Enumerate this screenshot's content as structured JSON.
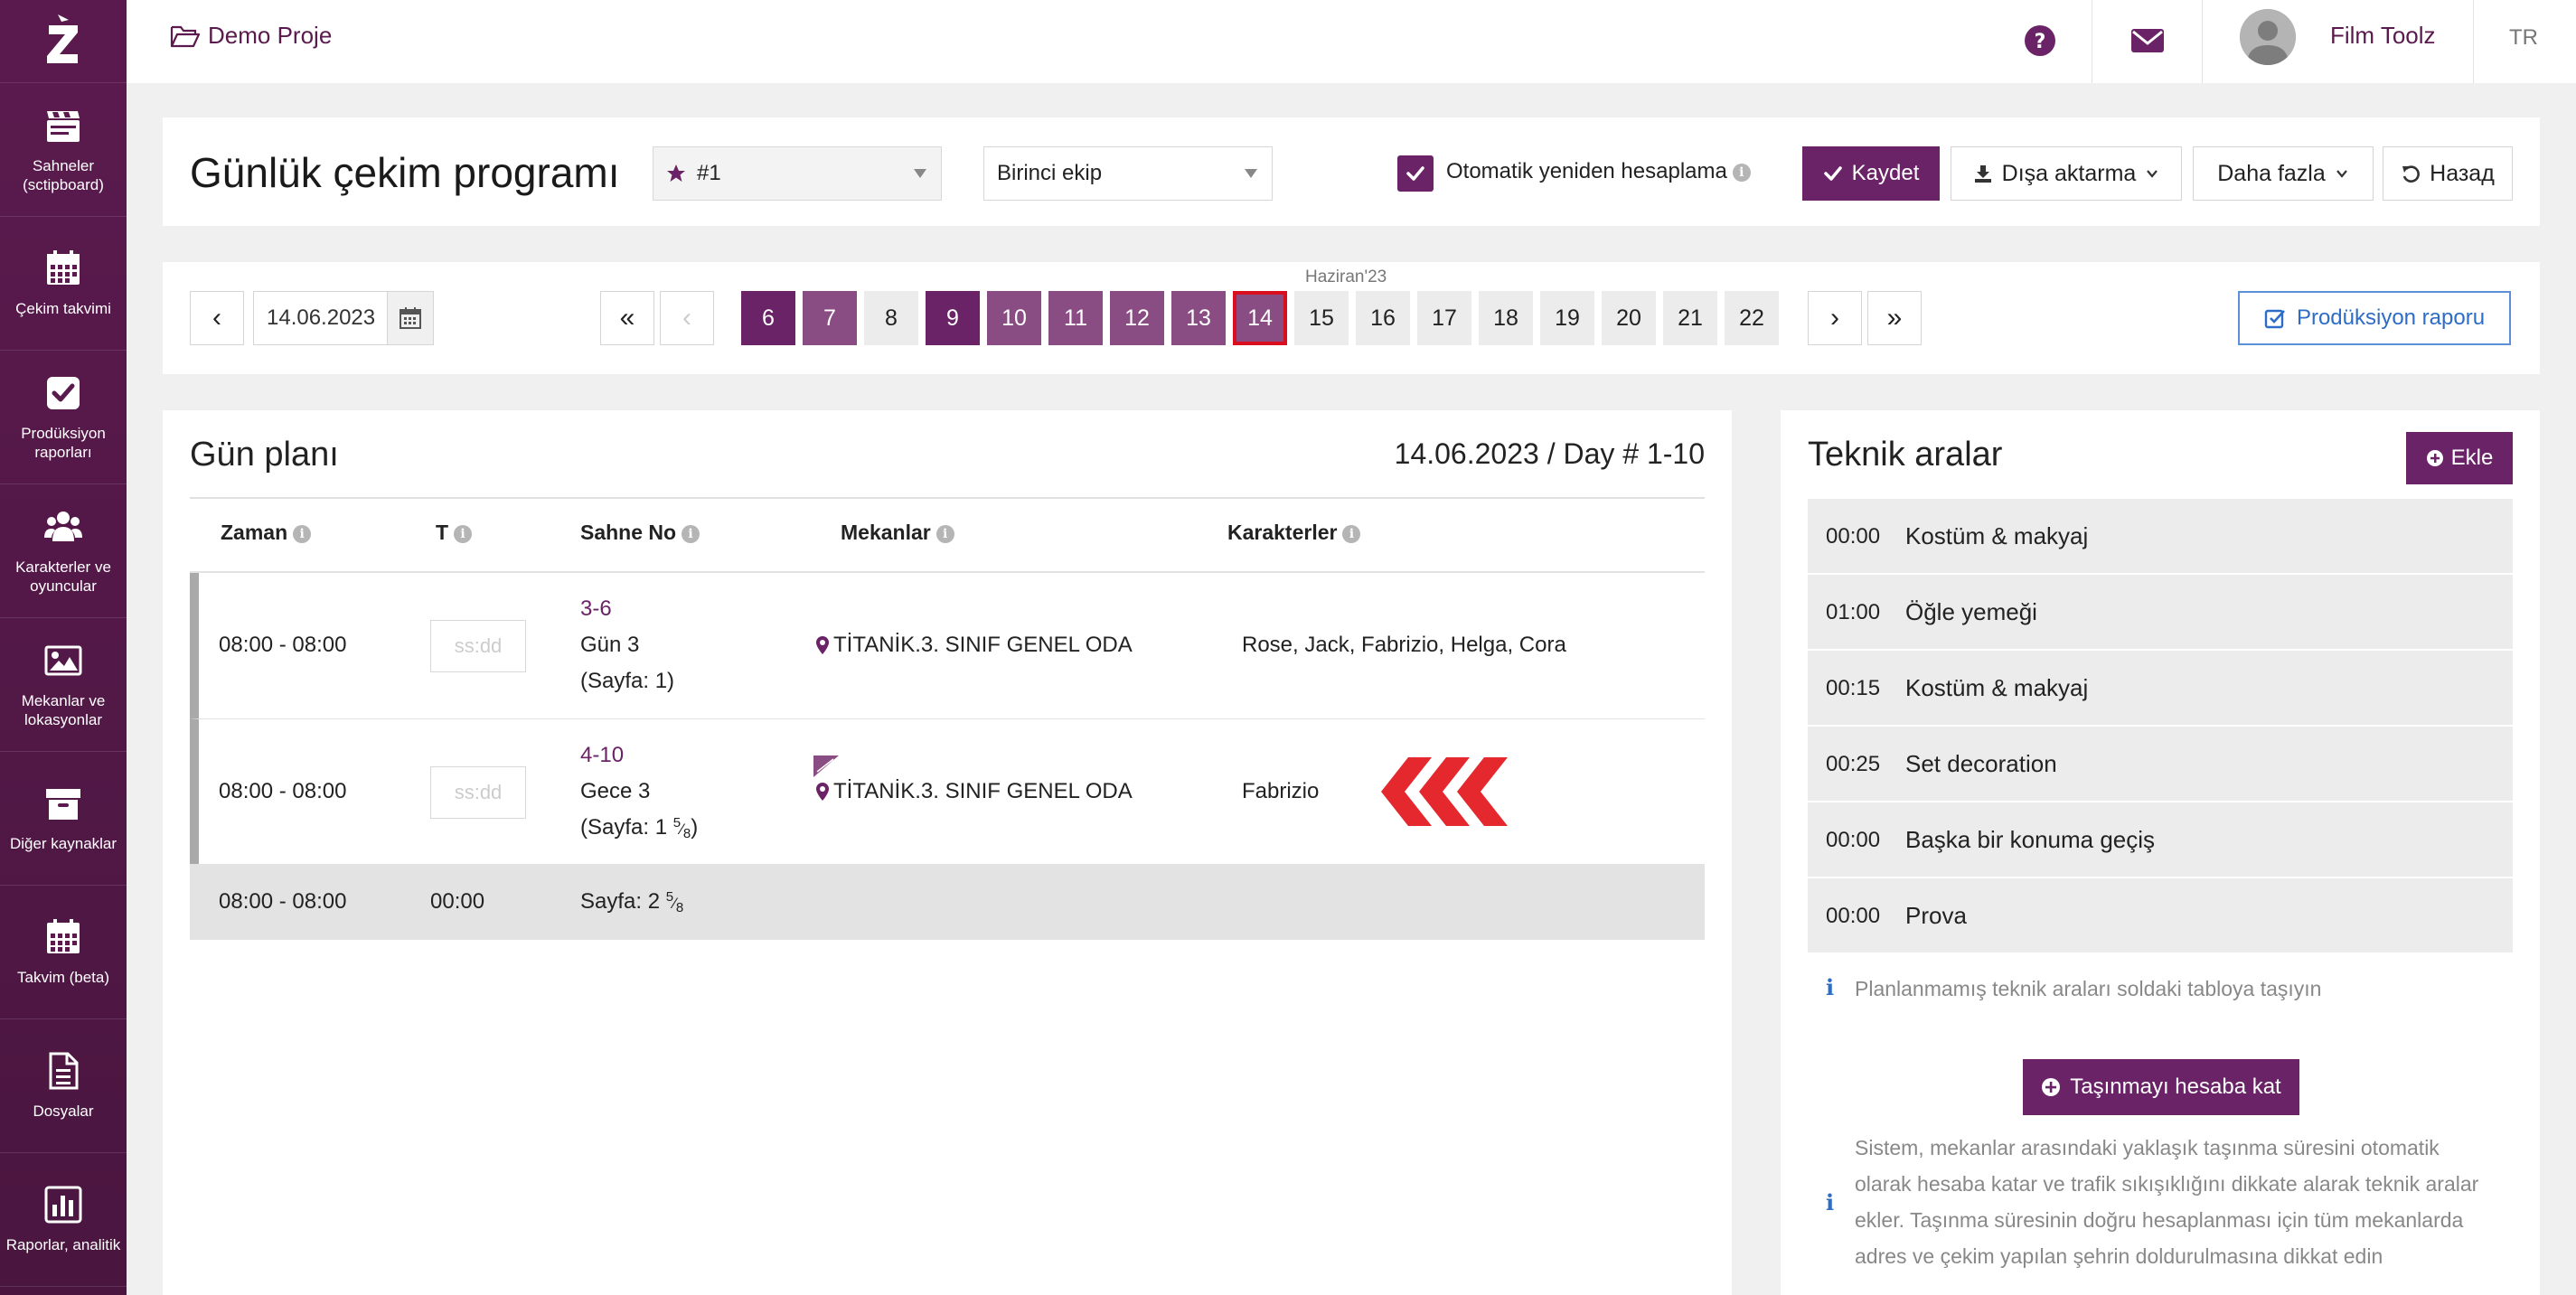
{
  "sidebar": {
    "items": [
      {
        "label": "Sahneler (sctipboard)",
        "icon": "clapperboard-icon"
      },
      {
        "label": "Çekim takvimi",
        "icon": "calendar-icon"
      },
      {
        "label": "Prodüksiyon raporları",
        "icon": "checkbox-icon"
      },
      {
        "label": "Karakterler ve oyuncular",
        "icon": "users-icon"
      },
      {
        "label": "Mekanlar ve lokasyonlar",
        "icon": "image-icon"
      },
      {
        "label": "Diğer kaynaklar",
        "icon": "archive-icon"
      },
      {
        "label": "Takvim (beta)",
        "icon": "calendar-icon"
      },
      {
        "label": "Dosyalar",
        "icon": "file-icon"
      },
      {
        "label": "Raporlar, analitik",
        "icon": "bar-chart-icon"
      }
    ]
  },
  "topbar": {
    "project": "Demo Proje",
    "user": "Film Toolz",
    "lang": "TR"
  },
  "header": {
    "title": "Günlük çekim programı",
    "schedule_select": "#1",
    "crew_select": "Birinci ekip",
    "auto_recalc_label": "Otomatik yeniden hesaplama",
    "save": "Kaydet",
    "export": "Dışa aktarma",
    "more": "Daha fazla",
    "back": "Назад"
  },
  "datenav": {
    "date": "14.06.2023",
    "month_label": "Haziran'23",
    "first": "«",
    "prev": "‹",
    "next": "›",
    "last": "»",
    "days": [
      {
        "label": "6",
        "state": "dark"
      },
      {
        "label": "7",
        "state": "mid"
      },
      {
        "label": "8",
        "state": "plain"
      },
      {
        "label": "9",
        "state": "dark"
      },
      {
        "label": "10",
        "state": "mid"
      },
      {
        "label": "11",
        "state": "mid"
      },
      {
        "label": "12",
        "state": "mid"
      },
      {
        "label": "13",
        "state": "mid"
      },
      {
        "label": "14",
        "state": "sel"
      },
      {
        "label": "15",
        "state": "plain"
      },
      {
        "label": "16",
        "state": "plain"
      },
      {
        "label": "17",
        "state": "plain"
      },
      {
        "label": "18",
        "state": "plain"
      },
      {
        "label": "19",
        "state": "plain"
      },
      {
        "label": "20",
        "state": "plain"
      },
      {
        "label": "21",
        "state": "plain"
      },
      {
        "label": "22",
        "state": "plain"
      }
    ],
    "report_button": "Prodüksiyon raporu"
  },
  "plan": {
    "title": "Gün planı",
    "date_day": "14.06.2023 / Day # 1-10",
    "columns": {
      "time": "Zaman",
      "t": "T",
      "scene": "Sahne No",
      "locations": "Mekanlar",
      "characters": "Karakterler"
    },
    "rows": [
      {
        "time": "08:00 - 08:00",
        "t_placeholder": "ss:dd",
        "scene_no": "3-6",
        "day_night": "Gün 3",
        "pages_prefix": "(Sayfa: 1)",
        "pages_frac_num": "",
        "pages_frac_den": "",
        "pages_suffix": "",
        "location": "TİTANİK.3. SINIF GENEL ODA",
        "characters": "Rose, Jack, Fabrizio, Helga, Cora"
      },
      {
        "time": "08:00 - 08:00",
        "t_placeholder": "ss:dd",
        "scene_no": "4-10",
        "day_night": "Gece 3",
        "pages_prefix": "(Sayfa: 1 ",
        "pages_frac_num": "5",
        "pages_frac_den": "8",
        "pages_suffix": ")",
        "location": "TİTANİK.3. SINIF GENEL ODA",
        "characters": "Fabrizio"
      }
    ],
    "total": {
      "time": "08:00 - 08:00",
      "t": "00:00",
      "pages_prefix": "Sayfa: 2 ",
      "pages_frac_num": "5",
      "pages_frac_den": "8"
    }
  },
  "tech": {
    "title": "Teknik aralar",
    "add": "Ekle",
    "items": [
      {
        "time": "00:00",
        "name": "Kostüm & makyaj"
      },
      {
        "time": "01:00",
        "name": "Öğle yemeği"
      },
      {
        "time": "00:15",
        "name": "Kostüm & makyaj"
      },
      {
        "time": "00:25",
        "name": "Set decoration"
      },
      {
        "time": "00:00",
        "name": "Başka bir konuma geçiş"
      },
      {
        "time": "00:00",
        "name": "Prova"
      }
    ],
    "note1": "Planlanmamış teknik araları soldaki tabloya taşıyın",
    "calc_button": "Taşınmayı hesaba kat",
    "note2_lines": [
      "Sistem, mekanlar arasındaki yaklaşık taşınma süresini otomatik",
      "olarak hesaba katar ve trafik sıkışıklığını dikkate alarak teknik aralar",
      "ekler. Taşınma süresinin doğru hesaplanması için tüm mekanlarda",
      "adres ve çekim yapılan şehrin doldurulmasına dikkat edin"
    ]
  },
  "colors": {
    "brand": "#6b2367",
    "brand_light": "#8a4d83",
    "selected_border": "#d90f1f",
    "link_blue": "#2d6cc7"
  }
}
